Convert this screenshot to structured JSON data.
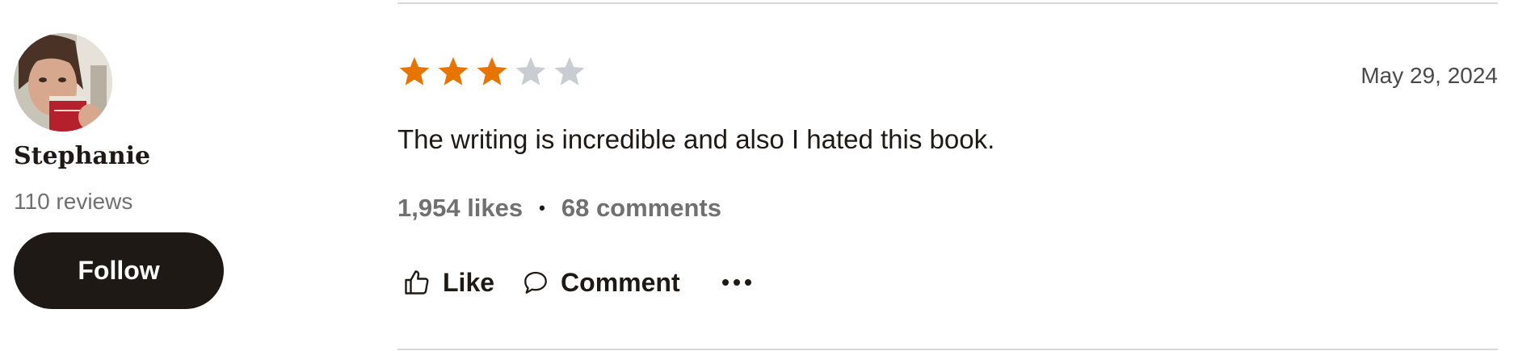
{
  "reviewer": {
    "name": "Stephanie",
    "review_count": "110 reviews",
    "follow_label": "Follow"
  },
  "review": {
    "rating": 3,
    "max_rating": 5,
    "date": "May 29, 2024",
    "text": "The writing is incredible and also I hated this book.",
    "likes": "1,954 likes",
    "separator": "•",
    "comments": "68 comments"
  },
  "actions": {
    "like_label": "Like",
    "comment_label": "Comment",
    "more_icon": "more-icon"
  },
  "colors": {
    "star_filled": "#e87400",
    "star_empty": "#c9ccd0",
    "button_bg": "#1e1915",
    "muted_text": "#707070"
  }
}
